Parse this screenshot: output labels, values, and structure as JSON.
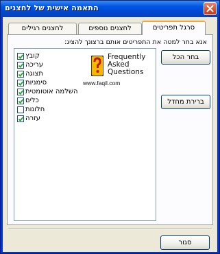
{
  "window": {
    "title": "התאמה אישית של לחצנים"
  },
  "tabs": [
    {
      "label": "סרגל תפריטים",
      "active": true
    },
    {
      "label": "לחצנים נוספים",
      "active": false
    },
    {
      "label": "לחצנים רגילים",
      "active": false
    }
  ],
  "instruction": "אנא בחר למטה את התפריטים אותם ברצונך להציג:",
  "menu_items": [
    {
      "label": "קובץ",
      "checked": true
    },
    {
      "label": "עריכה",
      "checked": true
    },
    {
      "label": "תצוגה",
      "checked": true
    },
    {
      "label": "סימניות",
      "checked": true
    },
    {
      "label": "השלמה אוטומטית",
      "checked": true
    },
    {
      "label": "כלים",
      "checked": true
    },
    {
      "label": "חלונות",
      "checked": false
    },
    {
      "label": "עזרה",
      "checked": true
    }
  ],
  "faq_logo": {
    "line1": "Frequently",
    "line2": "Asked",
    "line3": "Questions",
    "url": "www.faqil.com"
  },
  "buttons": {
    "select_all": "בחר הכל",
    "restore_default": "ברירת מחדל",
    "close": "סגור"
  },
  "colors": {
    "titlebar": "#0055e5",
    "close_button": "#d94e2a",
    "active_tab_accent": "#f7a63c",
    "dialog_background": "#ece9d8",
    "faq_badge": "#f5b800"
  }
}
